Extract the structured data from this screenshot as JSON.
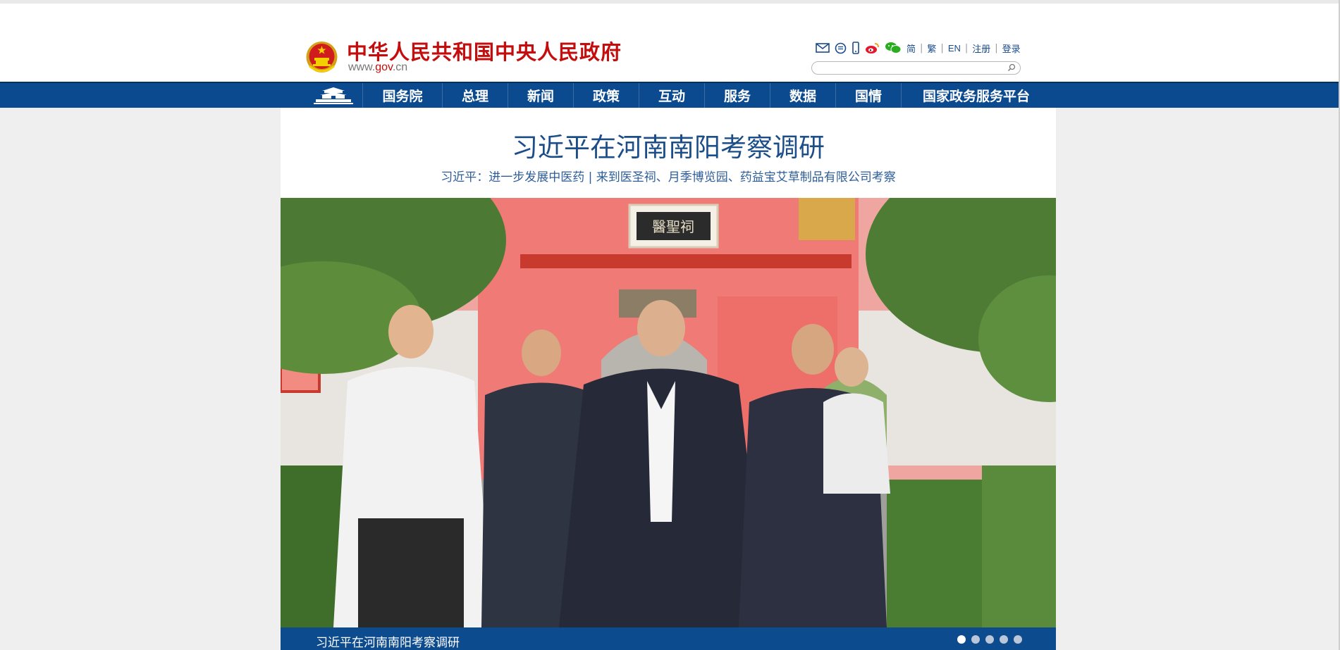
{
  "header": {
    "site_title": "中华人民共和国中央人民政府",
    "url_prefix": "www.",
    "url_gov": "gov",
    "url_suffix": ".cn",
    "tools": {
      "icons": [
        "mail-icon",
        "chat-icon",
        "mobile-icon",
        "weibo-icon",
        "wechat-icon"
      ],
      "links": [
        "简",
        "繁",
        "EN",
        "注册",
        "登录"
      ]
    },
    "search": {
      "value": ""
    }
  },
  "nav": {
    "home_icon": "tiananmen-icon",
    "items": [
      "国务院",
      "总理",
      "新闻",
      "政策",
      "互动",
      "服务",
      "数据",
      "国情",
      "国家政务服务平台"
    ]
  },
  "main": {
    "headline": "习近平在河南南阳考察调研",
    "subhead_lead": "习近平：进一步发展中医药",
    "subhead_sep": " | ",
    "subhead_link": "来到医圣祠、月季博览园、药益宝艾草制品有限公司考察",
    "plaque_text": "醫聖祠",
    "caption": "习近平在河南南阳考察调研",
    "slides_total": 5,
    "slide_active": 1
  },
  "colors": {
    "brand_red": "#c40d0d",
    "nav_blue": "#0b4a8f",
    "headline_blue": "#1b4d89",
    "wall_red": "#f07a75"
  }
}
